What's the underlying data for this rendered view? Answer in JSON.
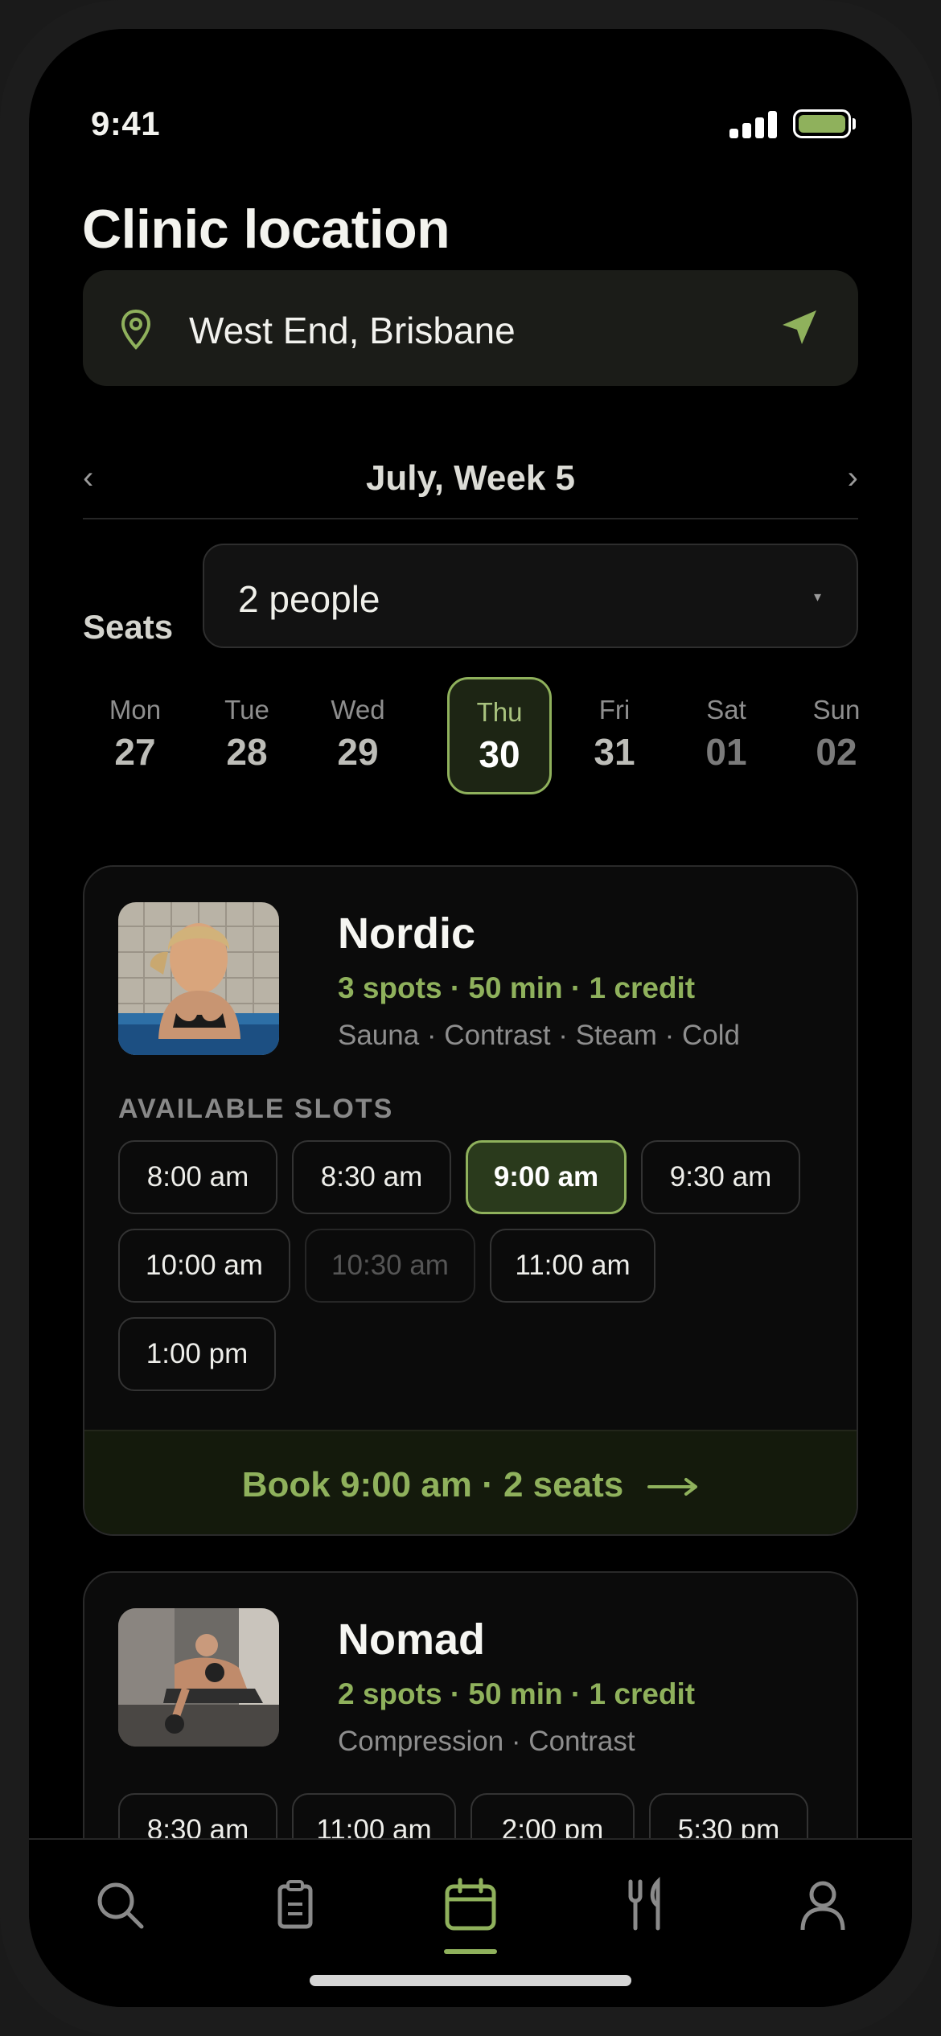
{
  "status": {
    "time": "9:41"
  },
  "page": {
    "title": "Clinic location"
  },
  "location": {
    "value": "West End, Brisbane"
  },
  "week": {
    "label": "July, Week 5",
    "prev": "‹",
    "next": "›"
  },
  "seats": {
    "label": "Seats",
    "value": "2 people",
    "caret": "▾"
  },
  "days": [
    {
      "name": "Mon",
      "num": "27"
    },
    {
      "name": "Tue",
      "num": "28"
    },
    {
      "name": "Wed",
      "num": "29"
    },
    {
      "name": "Thu",
      "num": "30",
      "selected": true
    },
    {
      "name": "Fri",
      "num": "31"
    },
    {
      "name": "Sat",
      "num": "01"
    },
    {
      "name": "Sun",
      "num": "02"
    }
  ],
  "cards": [
    {
      "name": "Nordic",
      "meta": "3 spots · 50 min · 1 credit",
      "tags": "Sauna · Contrast · Steam · Cold",
      "slots_heading": "AVAILABLE SLOTS",
      "slots": [
        "8:00 am",
        "8:30 am",
        "9:00 am",
        "9:30 am",
        "10:00 am",
        "10:30 am",
        "11:00 am",
        "1:00 pm"
      ],
      "selected_slot": "9:00 am",
      "disabled_slot": "10:30 am",
      "book_label": "Book 9:00 am · 2 seats"
    },
    {
      "name": "Nomad",
      "meta": "2 spots · 50 min · 1 credit",
      "tags": "Compression · Contrast",
      "slots": [
        "8:30 am",
        "11:00 am",
        "2:00 pm",
        "5:30 pm"
      ]
    }
  ],
  "tabbar": {
    "items": [
      "search-icon",
      "clipboard-icon",
      "calendar-icon",
      "utensils-icon",
      "person-icon"
    ],
    "active": "calendar-icon"
  },
  "colors": {
    "accent": "#8fb15c",
    "background": "#000000",
    "card": "#0b0b0b"
  }
}
